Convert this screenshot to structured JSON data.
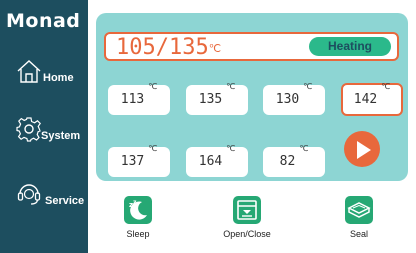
{
  "app": {
    "logo": "Monad"
  },
  "sidebar": {
    "items": [
      {
        "label": "Home",
        "icon": "home-icon"
      },
      {
        "label": "System",
        "icon": "gear-icon"
      },
      {
        "label": "Service",
        "icon": "headset-icon"
      }
    ]
  },
  "status": {
    "current": "105",
    "target": "135",
    "unit": "℃",
    "state": "Heating"
  },
  "zones": [
    {
      "value": "113",
      "unit": "℃"
    },
    {
      "value": "135",
      "unit": "℃"
    },
    {
      "value": "130",
      "unit": "℃"
    },
    {
      "value": "142",
      "unit": "℃"
    },
    {
      "value": "137",
      "unit": "℃"
    },
    {
      "value": "164",
      "unit": "℃"
    },
    {
      "value": "82",
      "unit": "℃"
    }
  ],
  "actions": [
    {
      "label": "Sleep",
      "icon": "sleep-icon"
    },
    {
      "label": "Open/Close",
      "icon": "tray-icon"
    },
    {
      "label": "Seal",
      "icon": "seal-icon"
    }
  ],
  "colors": {
    "sidebar": "#1d4e5f",
    "panel": "#8dd5d3",
    "accent": "#e8683c",
    "heating": "#2bb98b",
    "action": "#26a874"
  }
}
